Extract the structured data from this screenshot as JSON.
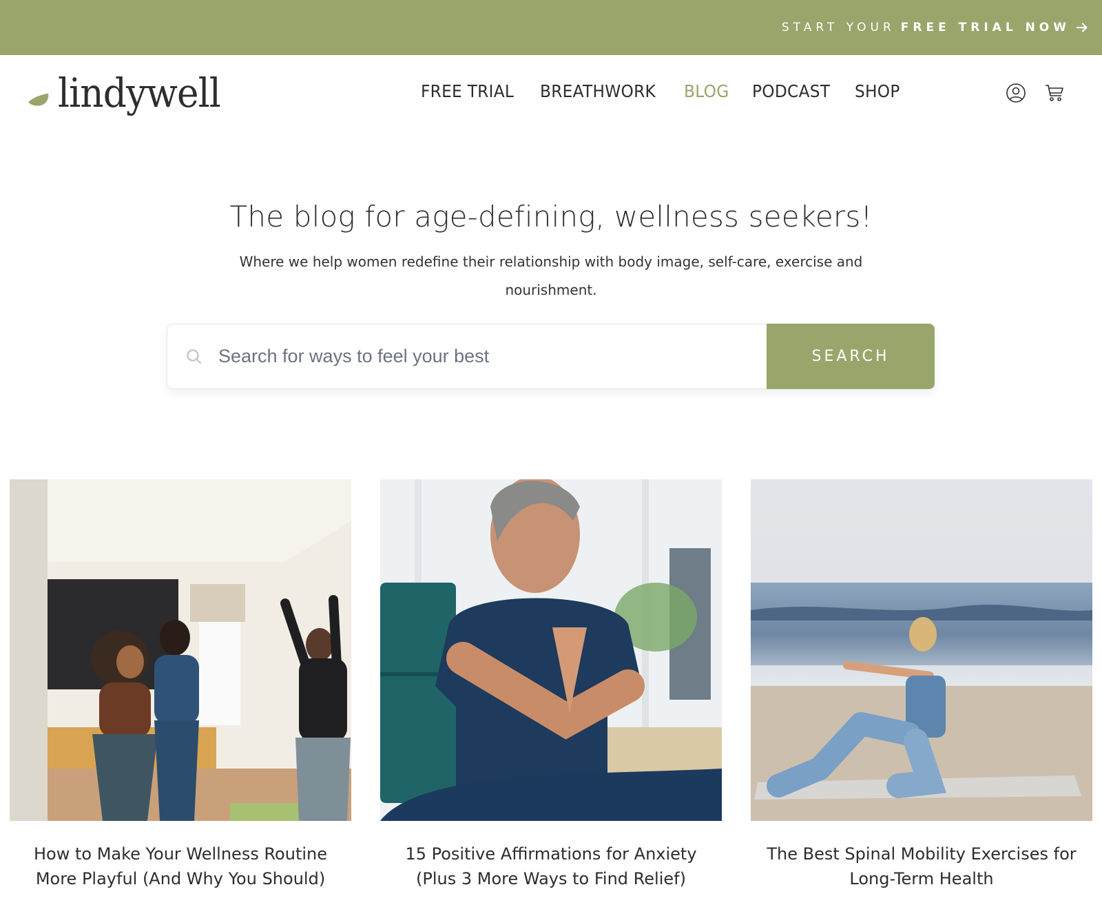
{
  "colors": {
    "brand_green": "#98a66b",
    "text_dark": "#2d2d2d",
    "background": "#ffffff"
  },
  "promo": {
    "prefix": "START YOUR",
    "emphasis": "FREE TRIAL NOW",
    "icon": "arrow-right-icon"
  },
  "header": {
    "logo_text": "lindywell",
    "logo_icon": "leaf-icon",
    "nav": [
      {
        "label": "FREE TRIAL",
        "active": false
      },
      {
        "label": "BREATHWORK",
        "active": false
      },
      {
        "label": "BLOG",
        "active": true
      },
      {
        "label": "PODCAST",
        "active": false
      },
      {
        "label": "SHOP",
        "active": false
      }
    ],
    "icons": [
      "user-account-icon",
      "shopping-cart-icon"
    ]
  },
  "hero": {
    "title": "The blog for age-defining, wellness seekers!",
    "subtitle": "Where we help women redefine their relationship with body image, self-care, exercise and nourishment."
  },
  "search": {
    "placeholder": "Search for ways to feel your best",
    "value": "",
    "button_label": "SEARCH",
    "icon": "search-icon"
  },
  "posts": [
    {
      "title": "How to Make Your Wellness Routine More Playful (And Why You Should)",
      "image": "three women dancing in a living room"
    },
    {
      "title": "15 Positive Affirmations for Anxiety (Plus 3 More Ways to Find Relief)",
      "image": "woman meditating with hands in prayer pose"
    },
    {
      "title": "The Best Spinal Mobility Exercises for Long-Term Health",
      "image": "woman doing pilates on a beach mat"
    }
  ]
}
